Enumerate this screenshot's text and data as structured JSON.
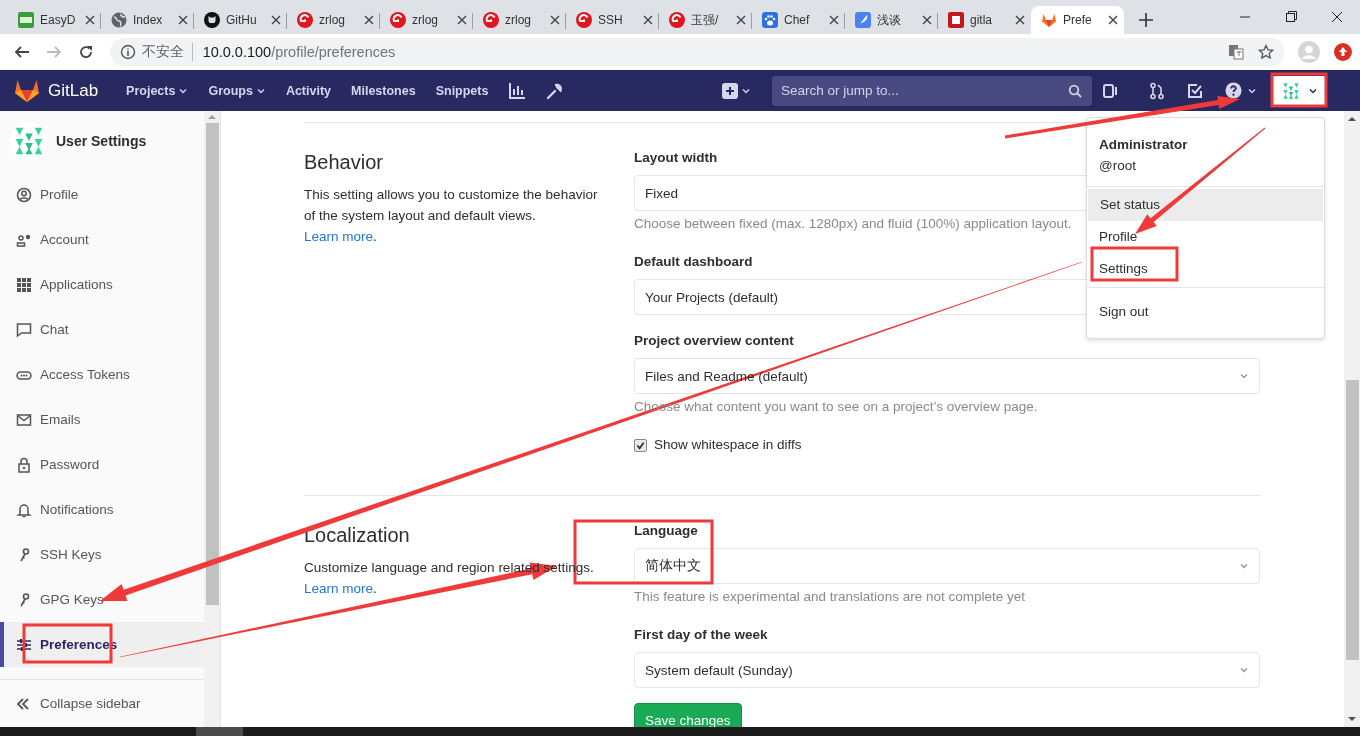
{
  "browser": {
    "tabs": [
      {
        "title": "EasyD",
        "kind": "sheet",
        "selected": false
      },
      {
        "title": "Index",
        "kind": "globe",
        "selected": false
      },
      {
        "title": "GitHu",
        "kind": "octocat",
        "selected": false
      },
      {
        "title": "zrlog",
        "kind": "g",
        "selected": false
      },
      {
        "title": "zrlog",
        "kind": "g",
        "selected": false
      },
      {
        "title": "zrlog",
        "kind": "g",
        "selected": false
      },
      {
        "title": "SSH",
        "kind": "g",
        "selected": false
      },
      {
        "title": "玉强/",
        "kind": "g",
        "selected": false
      },
      {
        "title": "Chef",
        "kind": "paw",
        "selected": false
      },
      {
        "title": "浅谈",
        "kind": "quill",
        "selected": false
      },
      {
        "title": "gitla",
        "kind": "square",
        "selected": false
      },
      {
        "title": "Prefe",
        "kind": "fox",
        "selected": true
      }
    ],
    "security": "不安全",
    "url_host": "10.0.0.100",
    "url_path": "/profile/preferences"
  },
  "navbar": {
    "brand": "GitLab",
    "items": [
      {
        "label": "Projects",
        "has_menu": true
      },
      {
        "label": "Groups",
        "has_menu": true
      },
      {
        "label": "Activity",
        "has_menu": false
      },
      {
        "label": "Milestones",
        "has_menu": false
      },
      {
        "label": "Snippets",
        "has_menu": false
      }
    ],
    "search": {
      "placeholder": "Search or jump to..."
    }
  },
  "sidebar": {
    "title": "User Settings",
    "items": [
      {
        "label": "Profile",
        "selected": false
      },
      {
        "label": "Account",
        "selected": false
      },
      {
        "label": "Applications",
        "selected": false
      },
      {
        "label": "Chat",
        "selected": false
      },
      {
        "label": "Access Tokens",
        "selected": false
      },
      {
        "label": "Emails",
        "selected": false
      },
      {
        "label": "Password",
        "selected": false
      },
      {
        "label": "Notifications",
        "selected": false
      },
      {
        "label": "SSH Keys",
        "selected": false
      },
      {
        "label": "GPG Keys",
        "selected": false
      },
      {
        "label": "Preferences",
        "selected": true
      }
    ],
    "collapse": "Collapse sidebar"
  },
  "sections": [
    {
      "title": "Behavior",
      "description": "This setting allows you to customize the behavior of the system layout and default views.",
      "link": "Learn more",
      "link_after": ".",
      "fields": [
        {
          "kind": "select",
          "label": "Layout width",
          "value": "Fixed",
          "help": "Choose between fixed (max. 1280px) and fluid (100%) application layout."
        },
        {
          "kind": "select",
          "label": "Default dashboard",
          "value": "Your Projects (default)"
        },
        {
          "kind": "select",
          "label": "Project overview content",
          "value": "Files and Readme (default)",
          "help": "Choose what content you want to see on a project’s overview page."
        },
        {
          "kind": "checkbox",
          "label": "Show whitespace in diffs",
          "checked": true
        }
      ]
    },
    {
      "title": "Localization",
      "description": "Customize language and region related settings.",
      "link": "Learn more",
      "link_after": ".",
      "fields": [
        {
          "kind": "select",
          "label": "Language",
          "value": "简体中文",
          "help": "This feature is experimental and translations are not complete yet"
        },
        {
          "kind": "select",
          "label": "First day of the week",
          "value": "System default (Sunday)"
        }
      ]
    }
  ],
  "save_button": "Save changes",
  "user_menu": {
    "name": "Administrator",
    "username": "@root",
    "groups": [
      [
        {
          "label": "Set status",
          "selected": true
        },
        {
          "label": "Profile",
          "selected": false
        },
        {
          "label": "Settings",
          "selected": false
        }
      ],
      [
        {
          "label": "Sign out",
          "selected": false
        }
      ]
    ]
  }
}
